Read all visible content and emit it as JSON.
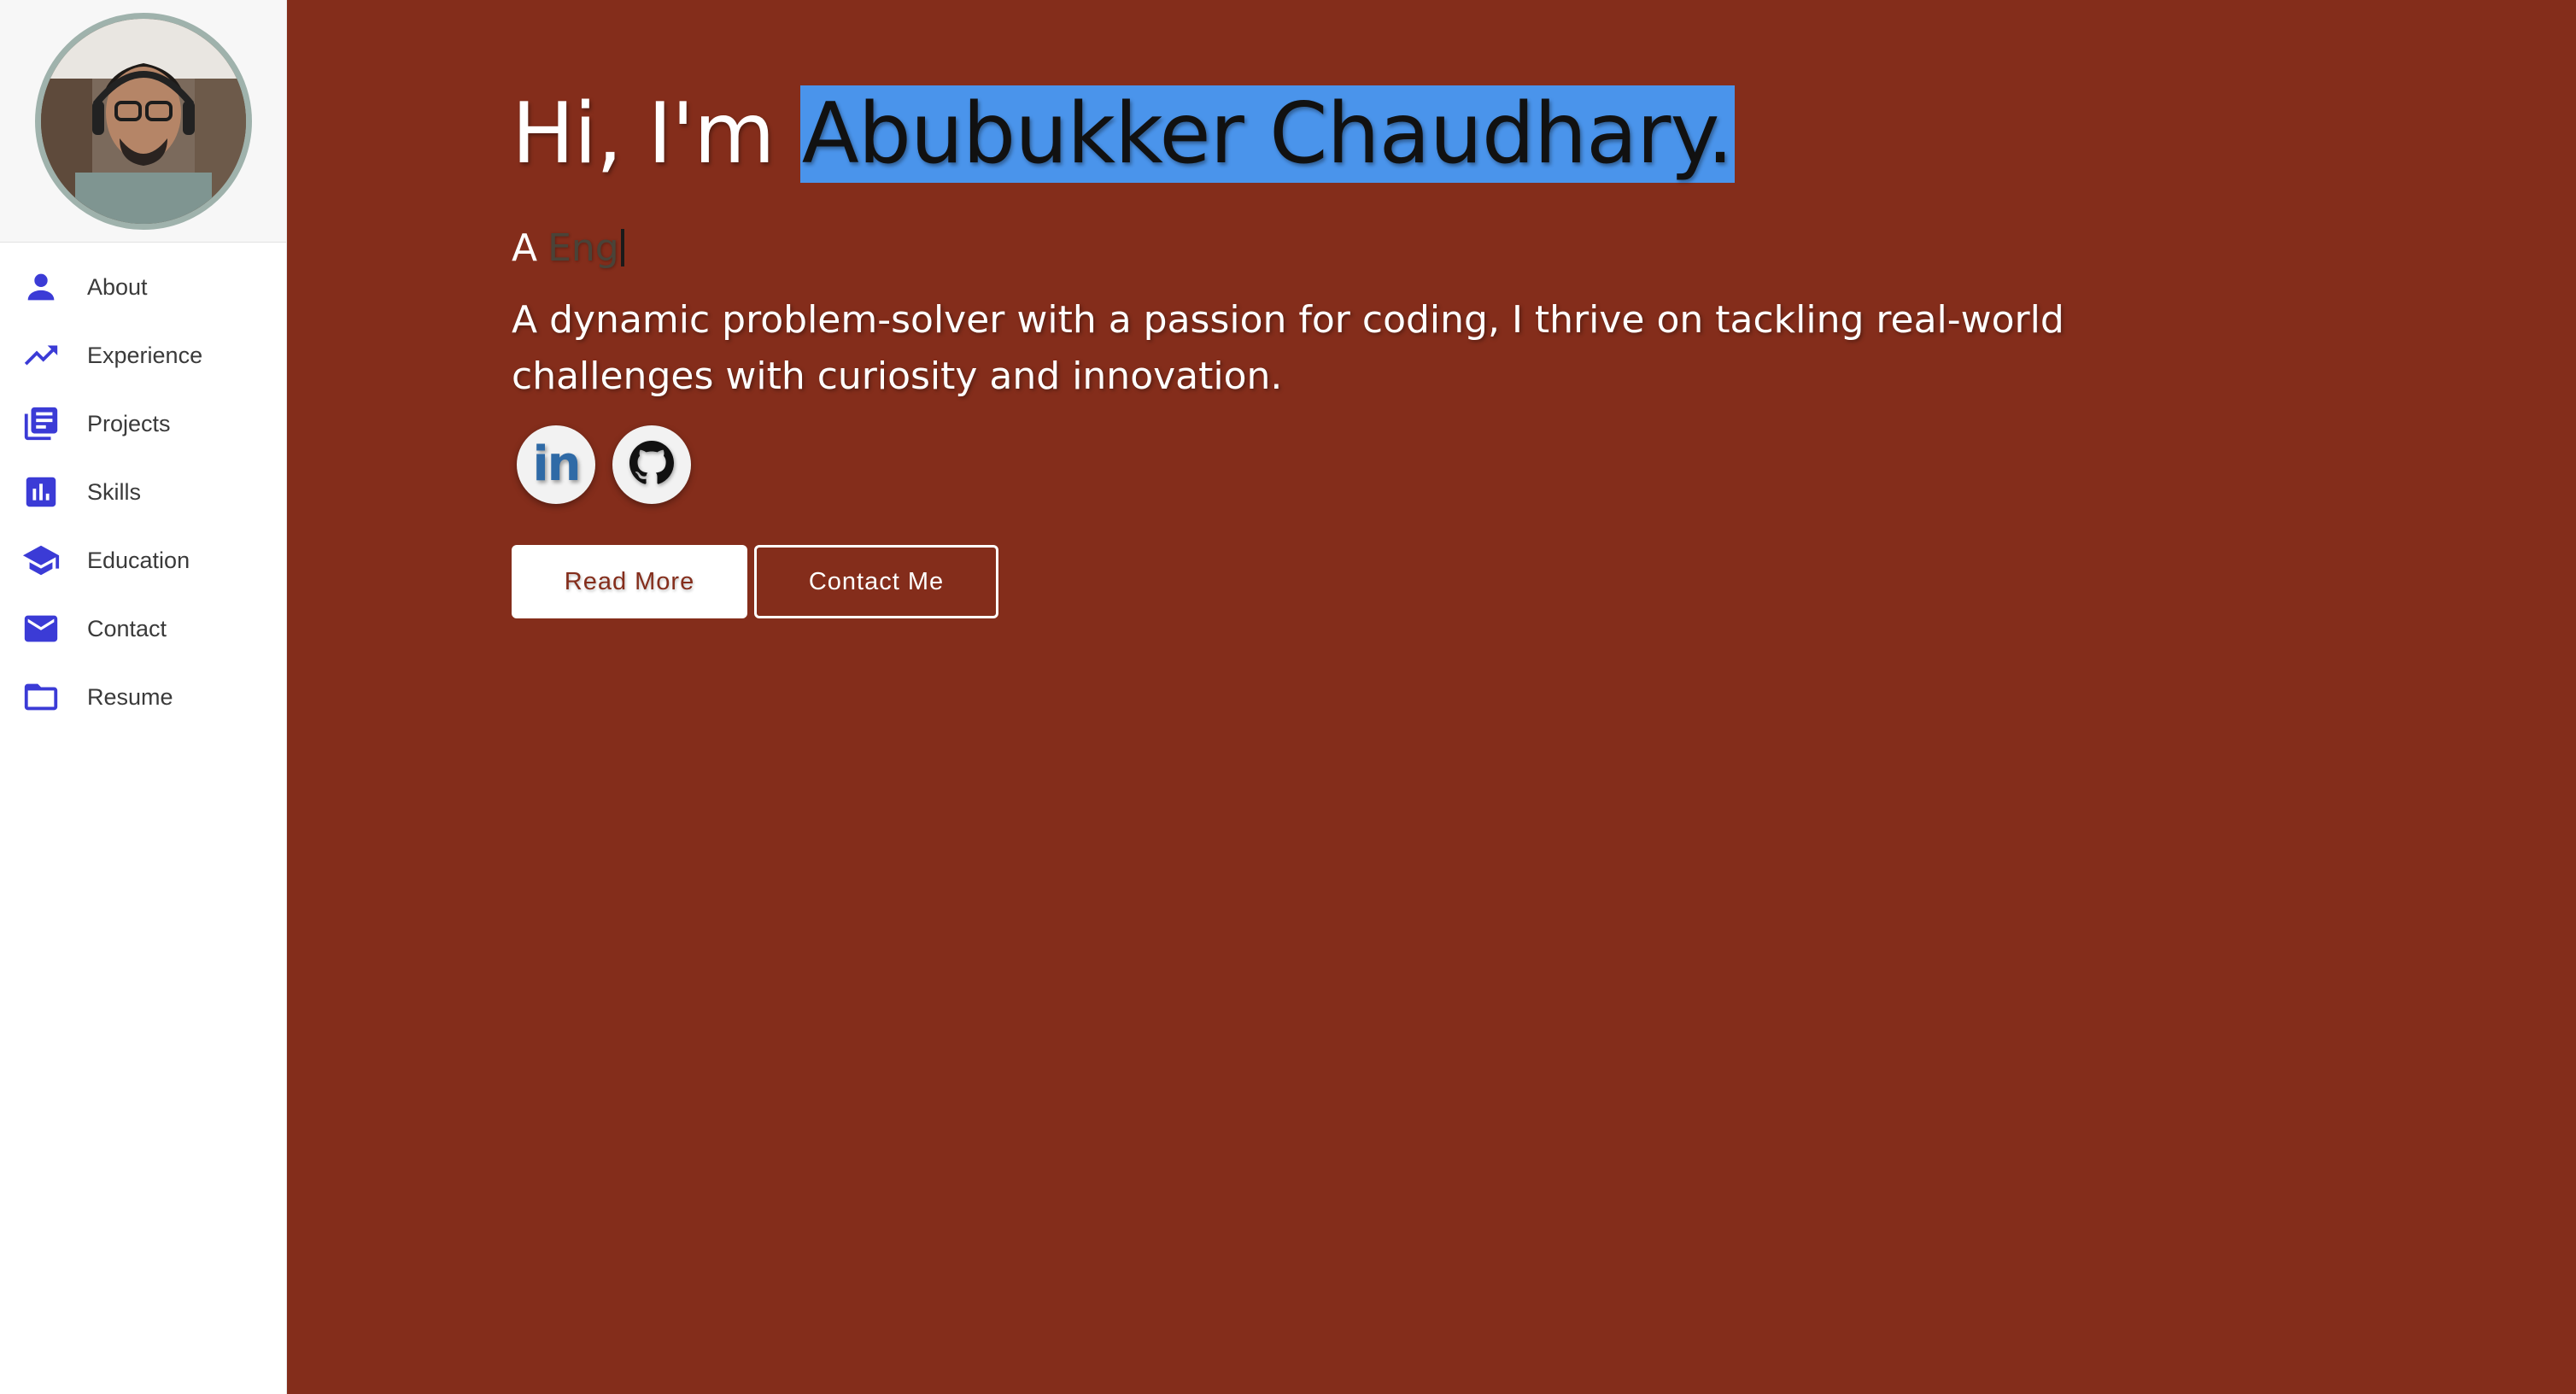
{
  "sidebar": {
    "profile": {
      "avatar_alt": "Profile photo"
    },
    "items": [
      {
        "label": "About",
        "icon": "person-icon"
      },
      {
        "label": "Experience",
        "icon": "trending-up-icon"
      },
      {
        "label": "Projects",
        "icon": "article-icon"
      },
      {
        "label": "Skills",
        "icon": "bar-chart-icon"
      },
      {
        "label": "Education",
        "icon": "graduation-cap-icon"
      },
      {
        "label": "Contact",
        "icon": "mail-icon"
      },
      {
        "label": "Resume",
        "icon": "folder-icon"
      }
    ],
    "icon_color": "#3b3bd6"
  },
  "hero": {
    "greeting_prefix": "Hi, I'm ",
    "name": "Abubukker Chaudhary.",
    "typed_prefix": "A",
    "typed_word": "Eng",
    "bio": "A dynamic problem-solver with a passion for coding, I thrive on tackling real-world challenges with curiosity and innovation.",
    "socials": [
      {
        "name": "linkedin",
        "icon": "linkedin-icon",
        "text": "in"
      },
      {
        "name": "github",
        "icon": "github-icon"
      }
    ],
    "buttons": {
      "read_more": "Read More",
      "contact_me": "Contact Me"
    }
  },
  "colors": {
    "background": "#842d1b",
    "highlight": "#4a94eb",
    "accent": "#3b3bd6"
  }
}
